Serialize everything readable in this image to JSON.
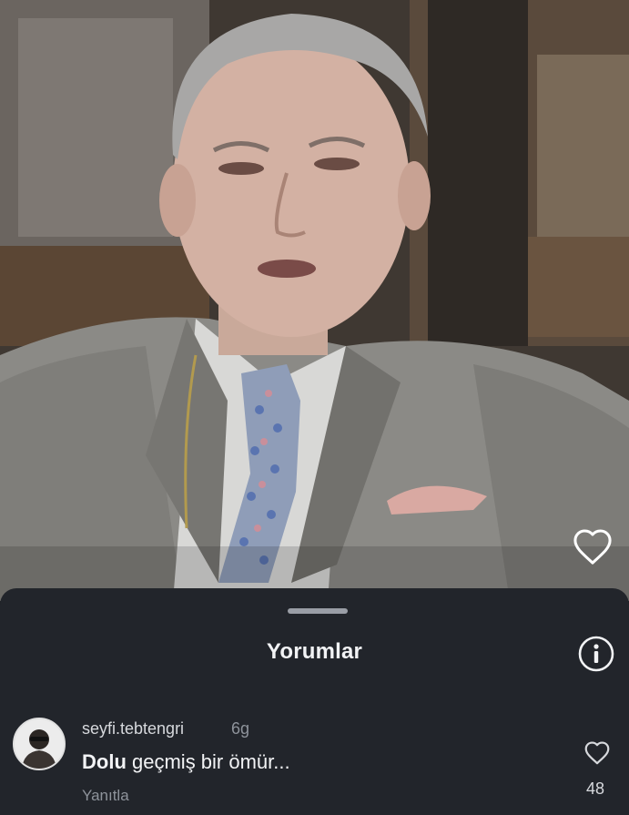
{
  "sheet": {
    "title": "Yorumlar"
  },
  "comment": {
    "username": "seyfi.tebtengri",
    "time": "6g",
    "text_bold": "Dolu",
    "text_rest": " geçmiş bir ömür...",
    "reply_label": "Yanıtla",
    "like_count": "48"
  },
  "icons": {
    "photo_like": "heart-outline-icon",
    "info": "info-circle-icon",
    "comment_like": "heart-outline-icon"
  },
  "colors": {
    "sheet_bg": "#22252b",
    "text_primary": "#f2f3f5",
    "text_secondary": "#8e939b"
  }
}
